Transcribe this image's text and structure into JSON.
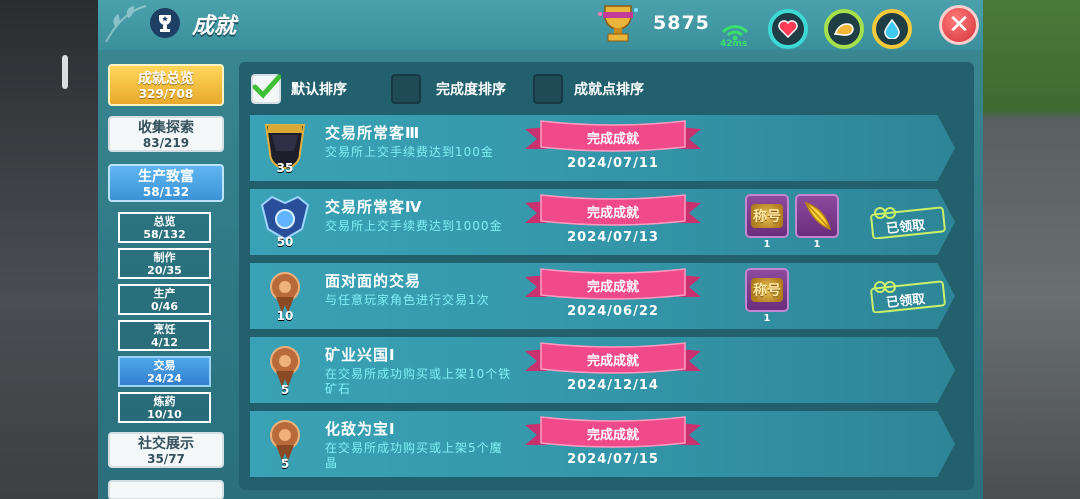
{
  "header": {
    "title": "成就",
    "points": "5875",
    "ping": "42ms"
  },
  "nav": {
    "overview": {
      "label": "成就总览",
      "count": "329/708"
    },
    "collect": {
      "label": "收集探索",
      "count": "83/219"
    },
    "produce": {
      "label": "生产致富",
      "count": "58/132"
    },
    "sub": [
      {
        "label": "总览",
        "count": "58/132",
        "active": false
      },
      {
        "label": "制作",
        "count": "20/35",
        "active": false
      },
      {
        "label": "生产",
        "count": "0/46",
        "active": false
      },
      {
        "label": "烹饪",
        "count": "4/12",
        "active": false
      },
      {
        "label": "交易",
        "count": "24/24",
        "active": true
      },
      {
        "label": "炼药",
        "count": "10/10",
        "active": false
      }
    ],
    "social": {
      "label": "社交展示",
      "count": "35/77"
    }
  },
  "sort": {
    "default": "默认排序",
    "completion": "完成度排序",
    "points": "成就点排序"
  },
  "achievements": [
    {
      "name": "交易所常客Ⅲ",
      "desc": "交易所上交手续费达到100金",
      "level": "35",
      "status": "完成成就",
      "date": "2024/07/11",
      "medal": "black",
      "rewards": [],
      "claimed": ""
    },
    {
      "name": "交易所常客Ⅳ",
      "desc": "交易所上交手续费达到1000金",
      "level": "50",
      "status": "完成成就",
      "date": "2024/07/13",
      "medal": "blue",
      "rewards": [
        {
          "label": "称号",
          "qty": "1",
          "icon": "title-badge"
        },
        {
          "label": "",
          "qty": "1",
          "icon": "golden-feather"
        }
      ],
      "claimed": "已领取"
    },
    {
      "name": "面对面的交易",
      "desc": "与任意玩家角色进行交易1次",
      "level": "10",
      "status": "完成成就",
      "date": "2024/06/22",
      "medal": "bronze",
      "rewards": [
        {
          "label": "称号",
          "qty": "1",
          "icon": "title-badge"
        }
      ],
      "claimed": "已领取"
    },
    {
      "name": "矿业兴国Ⅰ",
      "desc": "在交易所成功购买或上架10个铁矿石",
      "level": "5",
      "status": "完成成就",
      "date": "2024/12/14",
      "medal": "bronze",
      "rewards": [],
      "claimed": ""
    },
    {
      "name": "化敌为宝Ⅰ",
      "desc": "在交易所成功购买或上架5个魔晶",
      "level": "5",
      "status": "完成成就",
      "date": "2024/07/15",
      "medal": "bronze",
      "rewards": [],
      "claimed": ""
    }
  ]
}
